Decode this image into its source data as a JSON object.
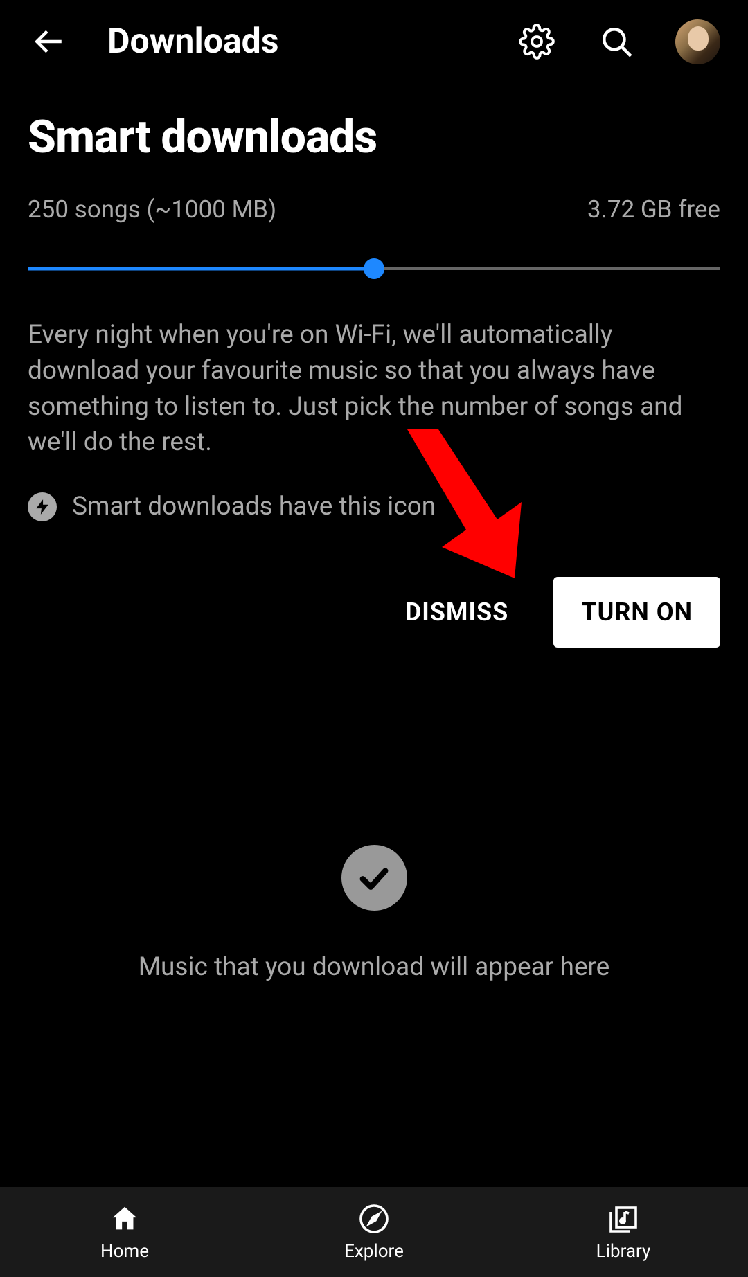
{
  "topbar": {
    "title": "Downloads"
  },
  "smartDownloads": {
    "heading": "Smart downloads",
    "songsInfo": "250 songs (~1000 MB)",
    "freeSpace": "3.72 GB free",
    "sliderPercent": 50,
    "description": "Every night when you're on Wi-Fi, we'll automatically download your favourite music so that you always have something to listen to. Just pick the number of songs and we'll do the rest.",
    "iconNote": "Smart downloads have this icon",
    "dismissLabel": "DISMISS",
    "turnOnLabel": "TURN ON"
  },
  "emptyState": {
    "text": "Music that you download will appear here"
  },
  "bottomNav": {
    "home": "Home",
    "explore": "Explore",
    "library": "Library"
  },
  "colors": {
    "accent": "#1e88ff",
    "annotation": "#ff0000"
  }
}
